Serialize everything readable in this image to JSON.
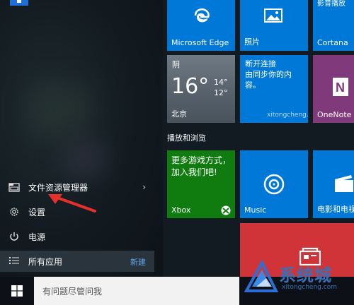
{
  "left_menu": {
    "items": [
      {
        "label": "文件资源管理器",
        "icon": "file-explorer-icon"
      },
      {
        "label": "设置",
        "icon": "gear-icon"
      },
      {
        "label": "电源",
        "icon": "power-icon"
      },
      {
        "label": "所有应用",
        "icon": "all-apps-icon"
      }
    ],
    "new_label": "新建"
  },
  "tiles": {
    "partial_text": "影音播放",
    "edge_label": "Microsoft Edge",
    "photos_label": "照片",
    "cortana_label": "Cortana",
    "weather": {
      "condition": "阴",
      "temp": "16°",
      "high": "14°",
      "low": "12°",
      "city": "北京"
    },
    "news": {
      "title": "断开连接",
      "body": "由同步你的内容。"
    },
    "onenote_label": "OneNote",
    "section_title": "播放和浏览",
    "xbox": {
      "promo": "更多游戏方式，加入我们吧!",
      "label": "Xbox"
    },
    "music_label": "Music",
    "movies_label": "电影和电视",
    "watermark_site": "xitongcheng.com",
    "watermark_text": "系统城",
    "watermark_small": "xitongcheng.com"
  },
  "taskbar": {
    "search_placeholder": "有问题尽管问我"
  },
  "colors": {
    "tile_blue": "#0078d7",
    "xbox_green": "#107c10",
    "onenote_purple": "#80397b",
    "store_red": "#d13438",
    "accent_link": "#5ea3e6"
  }
}
